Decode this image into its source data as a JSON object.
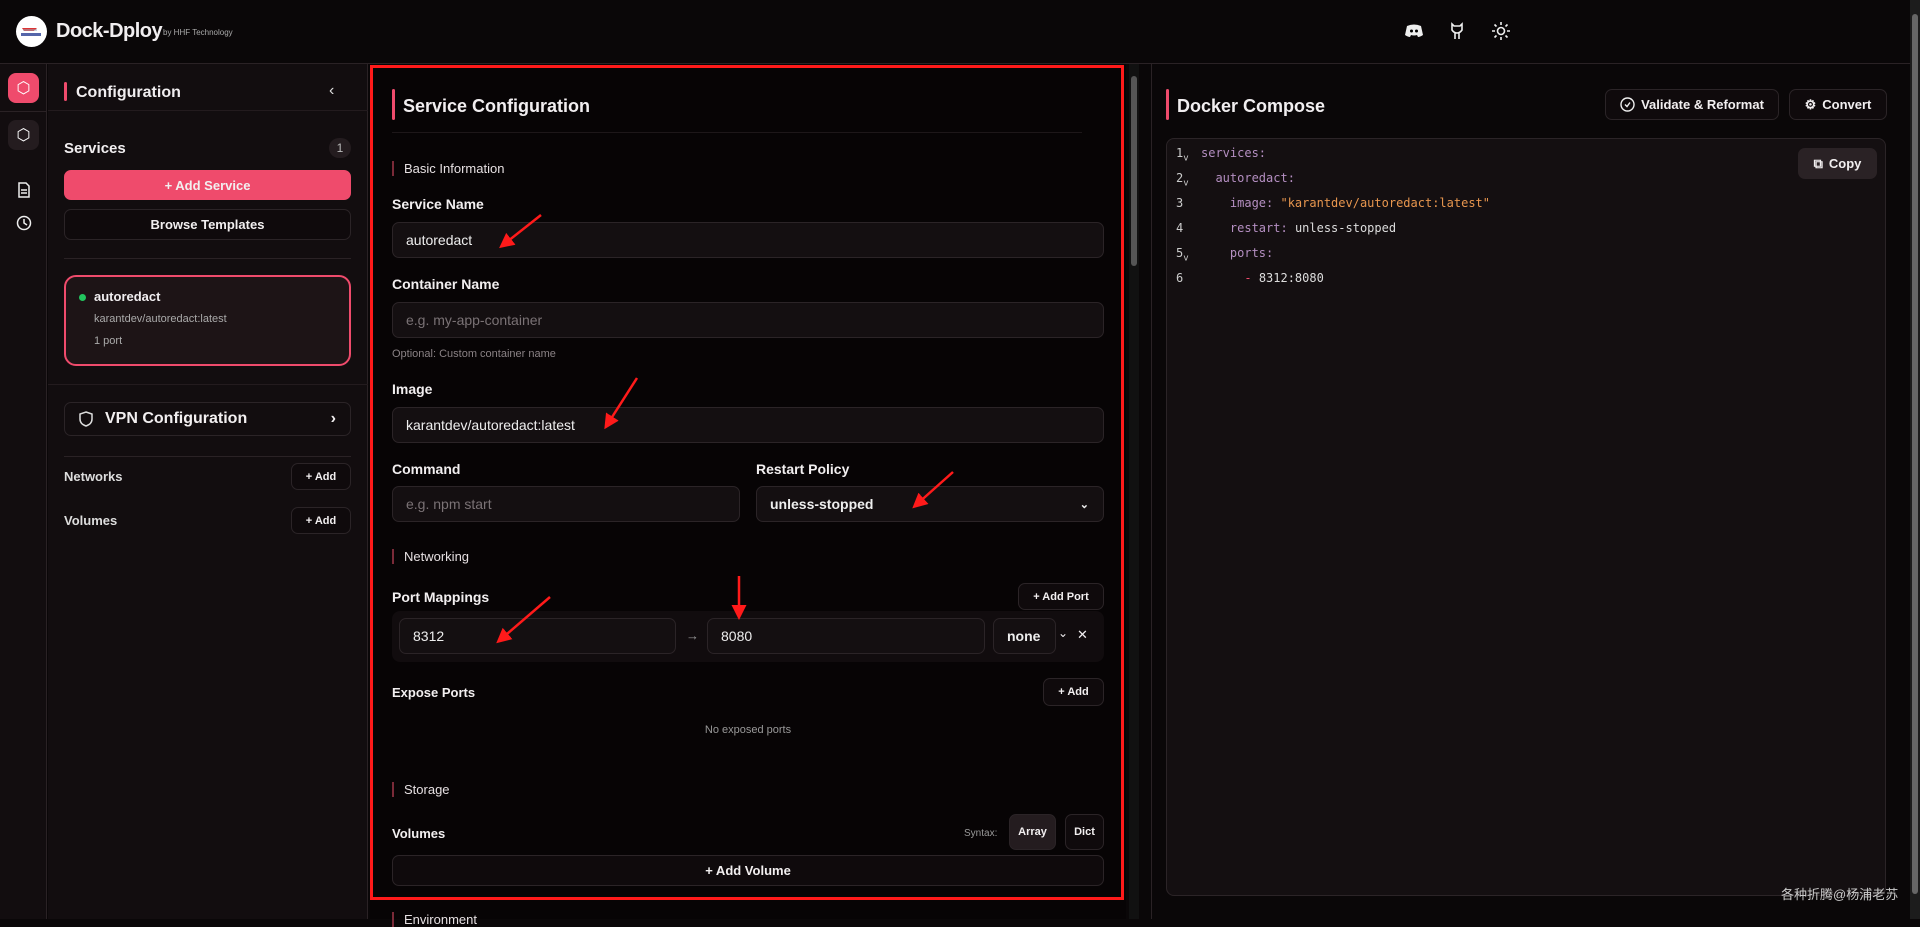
{
  "header": {
    "brand": "Dock-Dploy",
    "byline": "by HHF Technology",
    "icons": [
      "discord-icon",
      "github-icon",
      "sun-icon"
    ]
  },
  "rail": {
    "icons": [
      "box-icon",
      "box-icon",
      "file-text-icon",
      "clock-icon"
    ]
  },
  "config": {
    "title": "Configuration",
    "services_label": "Services",
    "services_count": "1",
    "add_service": "+ Add Service",
    "browse_templates": "Browse Templates",
    "service_card": {
      "name": "autoredact",
      "image": "karantdev/autoredact:latest",
      "ports": "1 port"
    },
    "vpn": "VPN Configuration",
    "networks": "Networks",
    "volumes": "Volumes",
    "add": "+ Add"
  },
  "service": {
    "title": "Service Configuration",
    "basic_info": "Basic Information",
    "service_name_label": "Service Name",
    "service_name": "autoredact",
    "container_name_label": "Container Name",
    "container_name_placeholder": "e.g. my-app-container",
    "container_hint": "Optional: Custom container name",
    "image_label": "Image",
    "image": "karantdev/autoredact:latest",
    "command_label": "Command",
    "command_placeholder": "e.g. npm start",
    "restart_label": "Restart Policy",
    "restart": "unless-stopped",
    "networking": "Networking",
    "port_mappings": "Port Mappings",
    "add_port": "+ Add Port",
    "port": {
      "host": "8312",
      "arrow": "→",
      "container": "8080",
      "protocol": "none",
      "remove": "✕"
    },
    "expose_ports": "Expose Ports",
    "add": "+ Add",
    "no_exposed": "No exposed ports",
    "storage": "Storage",
    "volumes": "Volumes",
    "syntax": "Syntax:",
    "array": "Array",
    "dict": "Dict",
    "add_volume": "+ Add Volume",
    "environment": "Environment"
  },
  "compose": {
    "title": "Docker Compose",
    "validate": "Validate & Reformat",
    "convert": "Convert",
    "copy": "Copy",
    "lines": [
      {
        "n": "1",
        "fold": "v",
        "indent": "",
        "key": "services",
        "sep": ":",
        "val": ""
      },
      {
        "n": "2",
        "fold": "v",
        "indent": "  ",
        "key": "autoredact",
        "sep": ":",
        "val": ""
      },
      {
        "n": "3",
        "fold": "",
        "indent": "    ",
        "key": "image",
        "sep": ": ",
        "val": "\"karantdev/autoredact:latest\""
      },
      {
        "n": "4",
        "fold": "",
        "indent": "    ",
        "key": "restart",
        "sep": ": ",
        "val": "unless-stopped"
      },
      {
        "n": "5",
        "fold": "v",
        "indent": "    ",
        "key": "ports",
        "sep": ":",
        "val": ""
      },
      {
        "n": "6",
        "fold": "",
        "indent": "      ",
        "key": "- ",
        "sep": "",
        "val": "8312:8080"
      }
    ]
  },
  "watermark": "各种折腾@杨浦老苏",
  "colors": {
    "accent": "#ef4b6c",
    "annotation": "#ff1a1a",
    "status": "#22c55e"
  }
}
